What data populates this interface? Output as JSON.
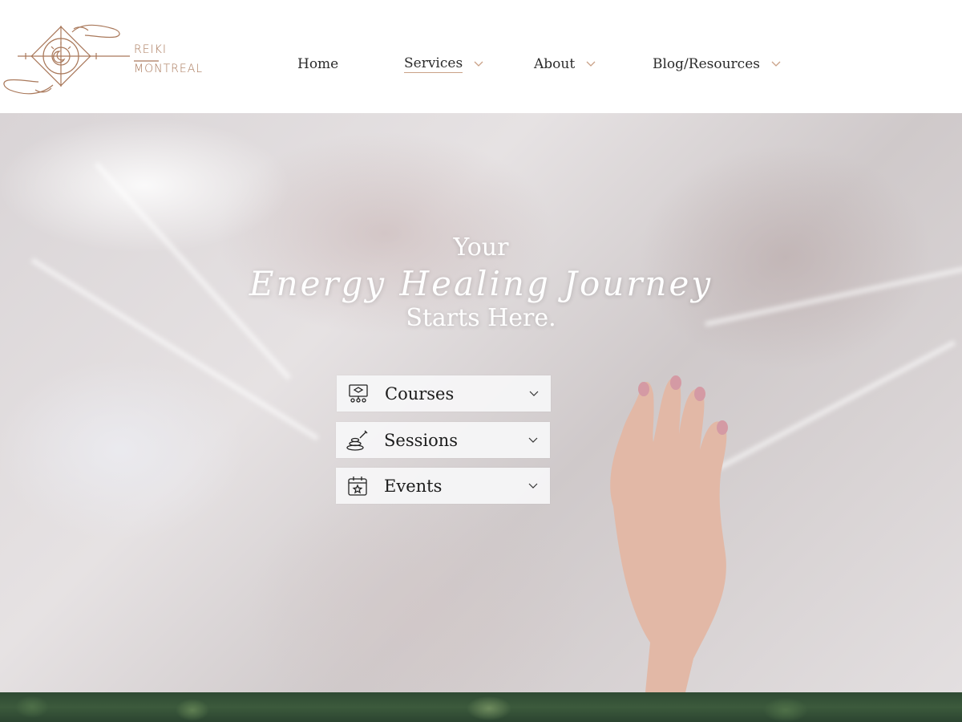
{
  "brand": {
    "line1": "REIKI",
    "line2": "MONTREAL",
    "accent_color": "#a9785a"
  },
  "nav": {
    "items": [
      {
        "label": "Home",
        "has_dropdown": false
      },
      {
        "label": "Services",
        "has_dropdown": true,
        "active": true
      },
      {
        "label": "About",
        "has_dropdown": true
      },
      {
        "label": "Blog/Resources",
        "has_dropdown": true
      }
    ]
  },
  "hero": {
    "line1": "Your",
    "line2": "Energy Healing Journey",
    "line3": "Starts Here."
  },
  "accordions": [
    {
      "label": "Courses",
      "icon": "classroom-icon"
    },
    {
      "label": "Sessions",
      "icon": "massage-stones-icon"
    },
    {
      "label": "Events",
      "icon": "calendar-star-icon"
    }
  ]
}
